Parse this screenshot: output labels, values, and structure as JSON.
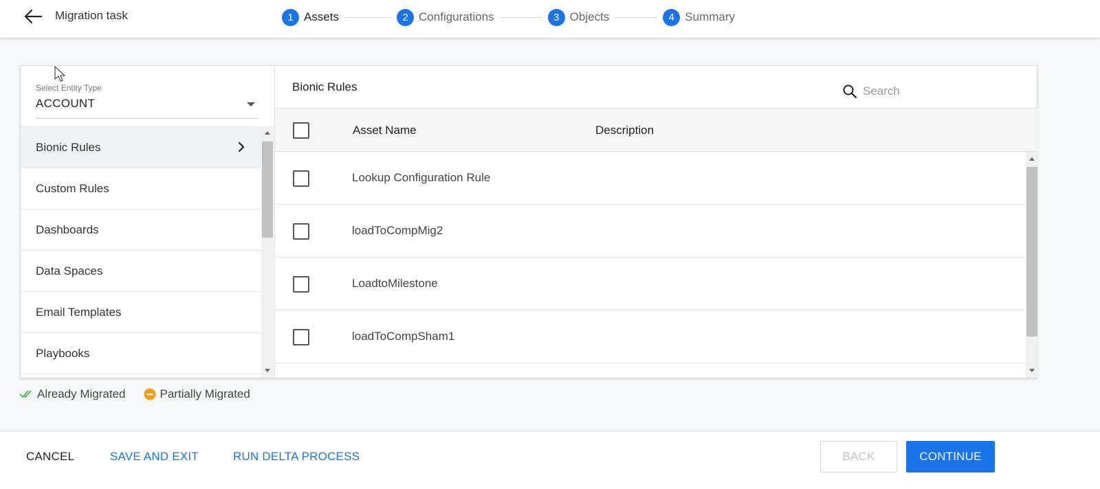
{
  "header": {
    "title": "Migration task",
    "steps": [
      {
        "num": "1",
        "label": "Assets",
        "active": true
      },
      {
        "num": "2",
        "label": "Configurations",
        "active": false
      },
      {
        "num": "3",
        "label": "Objects",
        "active": false
      },
      {
        "num": "4",
        "label": "Summary",
        "active": false
      }
    ]
  },
  "entity_select": {
    "caption": "Select Entity Type",
    "value": "ACCOUNT"
  },
  "asset_types": [
    {
      "label": "Bionic Rules",
      "selected": true
    },
    {
      "label": "Custom Rules",
      "selected": false
    },
    {
      "label": "Dashboards",
      "selected": false
    },
    {
      "label": "Data Spaces",
      "selected": false
    },
    {
      "label": "Email Templates",
      "selected": false
    },
    {
      "label": "Playbooks",
      "selected": false
    }
  ],
  "assets_panel": {
    "title": "Bionic Rules",
    "search_placeholder": "Search",
    "columns": [
      "Asset Name",
      "Description"
    ],
    "rows": [
      {
        "name": "Lookup Configuration Rule",
        "description": ""
      },
      {
        "name": "loadToCompMig2",
        "description": ""
      },
      {
        "name": "LoadtoMilestone",
        "description": ""
      },
      {
        "name": "loadToCompSham1",
        "description": ""
      }
    ]
  },
  "legend": {
    "already_migrated": "Already Migrated",
    "partially_migrated": "Partially Migrated"
  },
  "footer": {
    "cancel": "CANCEL",
    "save_and_exit": "SAVE AND EXIT",
    "run_delta": "RUN DELTA PROCESS",
    "back": "BACK",
    "continue": "CONTINUE"
  },
  "colors": {
    "accent": "#1a73e8",
    "migrated_check": "#4caf50",
    "partial": "#f39c1f"
  },
  "icons": {
    "back": "arrow-left-icon",
    "search": "search-icon",
    "chevron": "chevron-right-icon",
    "dropdown": "caret-down-icon"
  }
}
